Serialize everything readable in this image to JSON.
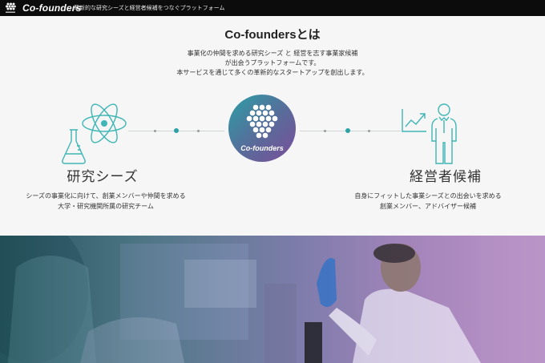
{
  "header": {
    "brand": "Co-founders",
    "tagline": "革新的な研究シーズと経営者候補をつなぐプラットフォーム",
    "logo_icon": "honeycomb-logo-icon"
  },
  "intro": {
    "title": "Co-foundersとは",
    "lines": [
      "事業化の仲間を求める研究シーズ と 経営を志す事業家候補",
      "が出会うプラットフォームです。",
      "本サービスを通じて多くの革新的なスタートアップを創出します。"
    ]
  },
  "center": {
    "label": "Co-founders",
    "icon": "honeycomb-icon"
  },
  "research": {
    "title": "研究シーズ",
    "lines": [
      "シーズの事業化に向けて、創業メンバーや仲間を求める",
      "大学・研究機関所属の研究チーム"
    ],
    "icons": [
      "atom-icon",
      "flask-icon"
    ]
  },
  "executive": {
    "title": "経営者候補",
    "lines": [
      "自身にフィットした事業シーズとの出会いを求める",
      "創業メンバー、アドバイザー候補"
    ],
    "icons": [
      "growth-chart-icon",
      "person-icon"
    ]
  },
  "hero_image": {
    "subject": "laboratory-researchers-photo"
  },
  "colors": {
    "accent": "#2aa3a8",
    "header_bg": "#0c0c0c",
    "icon_stroke": "#3fb5b5",
    "photo_tint_left": "#2d5e66",
    "photo_tint_right": "#b993c6"
  }
}
